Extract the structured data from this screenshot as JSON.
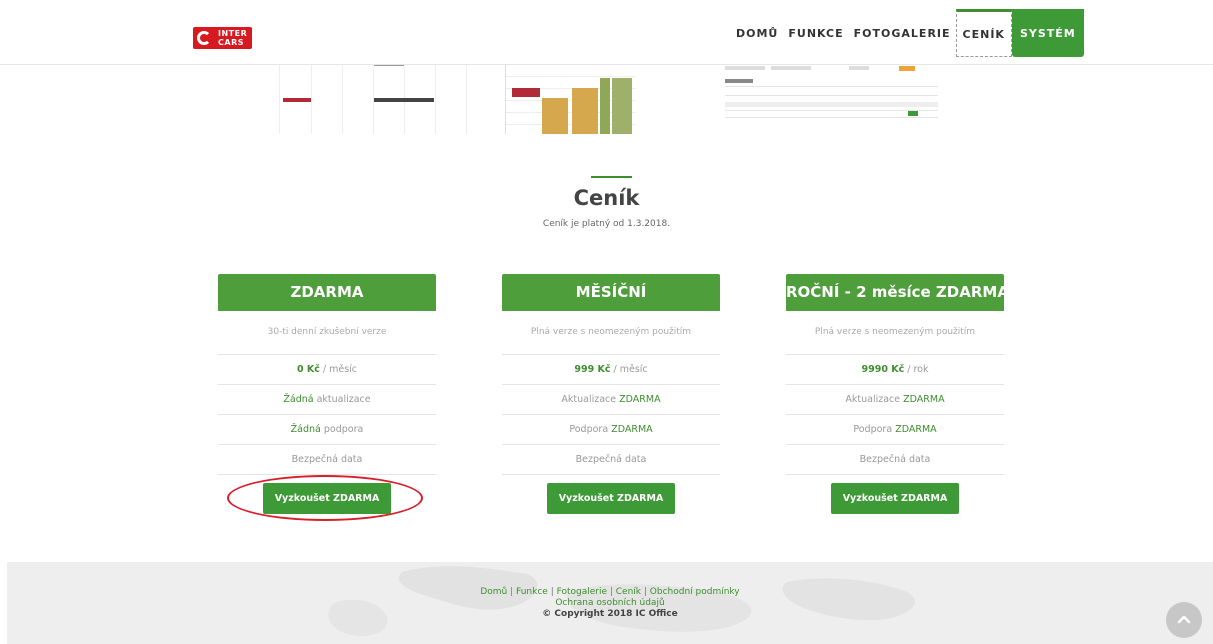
{
  "header": {
    "logo_text": "INTER\nCARS",
    "nav": [
      {
        "label": "DOMŮ"
      },
      {
        "label": "FUNKCE"
      },
      {
        "label": "FOTOGALERIE"
      },
      {
        "label": "CENÍK",
        "active": true
      },
      {
        "label": "SYSTÉM"
      }
    ]
  },
  "pricing": {
    "title": "Ceník",
    "subtitle": "Ceník je platný od 1.3.2018.",
    "plans": [
      {
        "name": "ZDARMA",
        "description": "30-ti denní zkušební verze",
        "price": "0 Kč",
        "period": " / měsíc",
        "update_prefix": "Žádná",
        "update_suffix": " aktualizace",
        "support_prefix": "Žádná",
        "support_suffix": " podpora",
        "data": "Bezpečná data",
        "button": "Vyzkoušet ZDARMA"
      },
      {
        "name": "MĚSÍČNÍ",
        "description": "Plná verze s neomezeným použitím",
        "price": "999 Kč",
        "period": " / měsíc",
        "update_prefix": "Aktualizace ",
        "update_suffix": "ZDARMA",
        "support_prefix": "Podpora ",
        "support_suffix": "ZDARMA",
        "data": "Bezpečná data",
        "button": "Vyzkoušet ZDARMA"
      },
      {
        "name": "ROČNÍ - 2 měsíce ZDARMA",
        "description": "Plná verze s neomezeným použitím",
        "price": "9990 Kč",
        "period": " / rok",
        "update_prefix": "Aktualizace ",
        "update_suffix": "ZDARMA",
        "support_prefix": "Podpora ",
        "support_suffix": "ZDARMA",
        "data": "Bezpečná data",
        "button": "Vyzkoušet ZDARMA"
      }
    ]
  },
  "footer": {
    "links": [
      "Domů",
      "Funkce",
      "Fotogalerie",
      "Ceník",
      "Obchodní podmínky"
    ],
    "separator": " | ",
    "privacy": "Ochrana osobních údajů",
    "copyright": "© Copyright 2018 IC Office"
  },
  "colors": {
    "accent_green": "#3e9a36",
    "card_header_green": "#4f9e3c",
    "highlight_red": "#d8202b",
    "logo_red": "#d71920"
  },
  "icons": {
    "scroll_top": "chevron-up-icon"
  }
}
